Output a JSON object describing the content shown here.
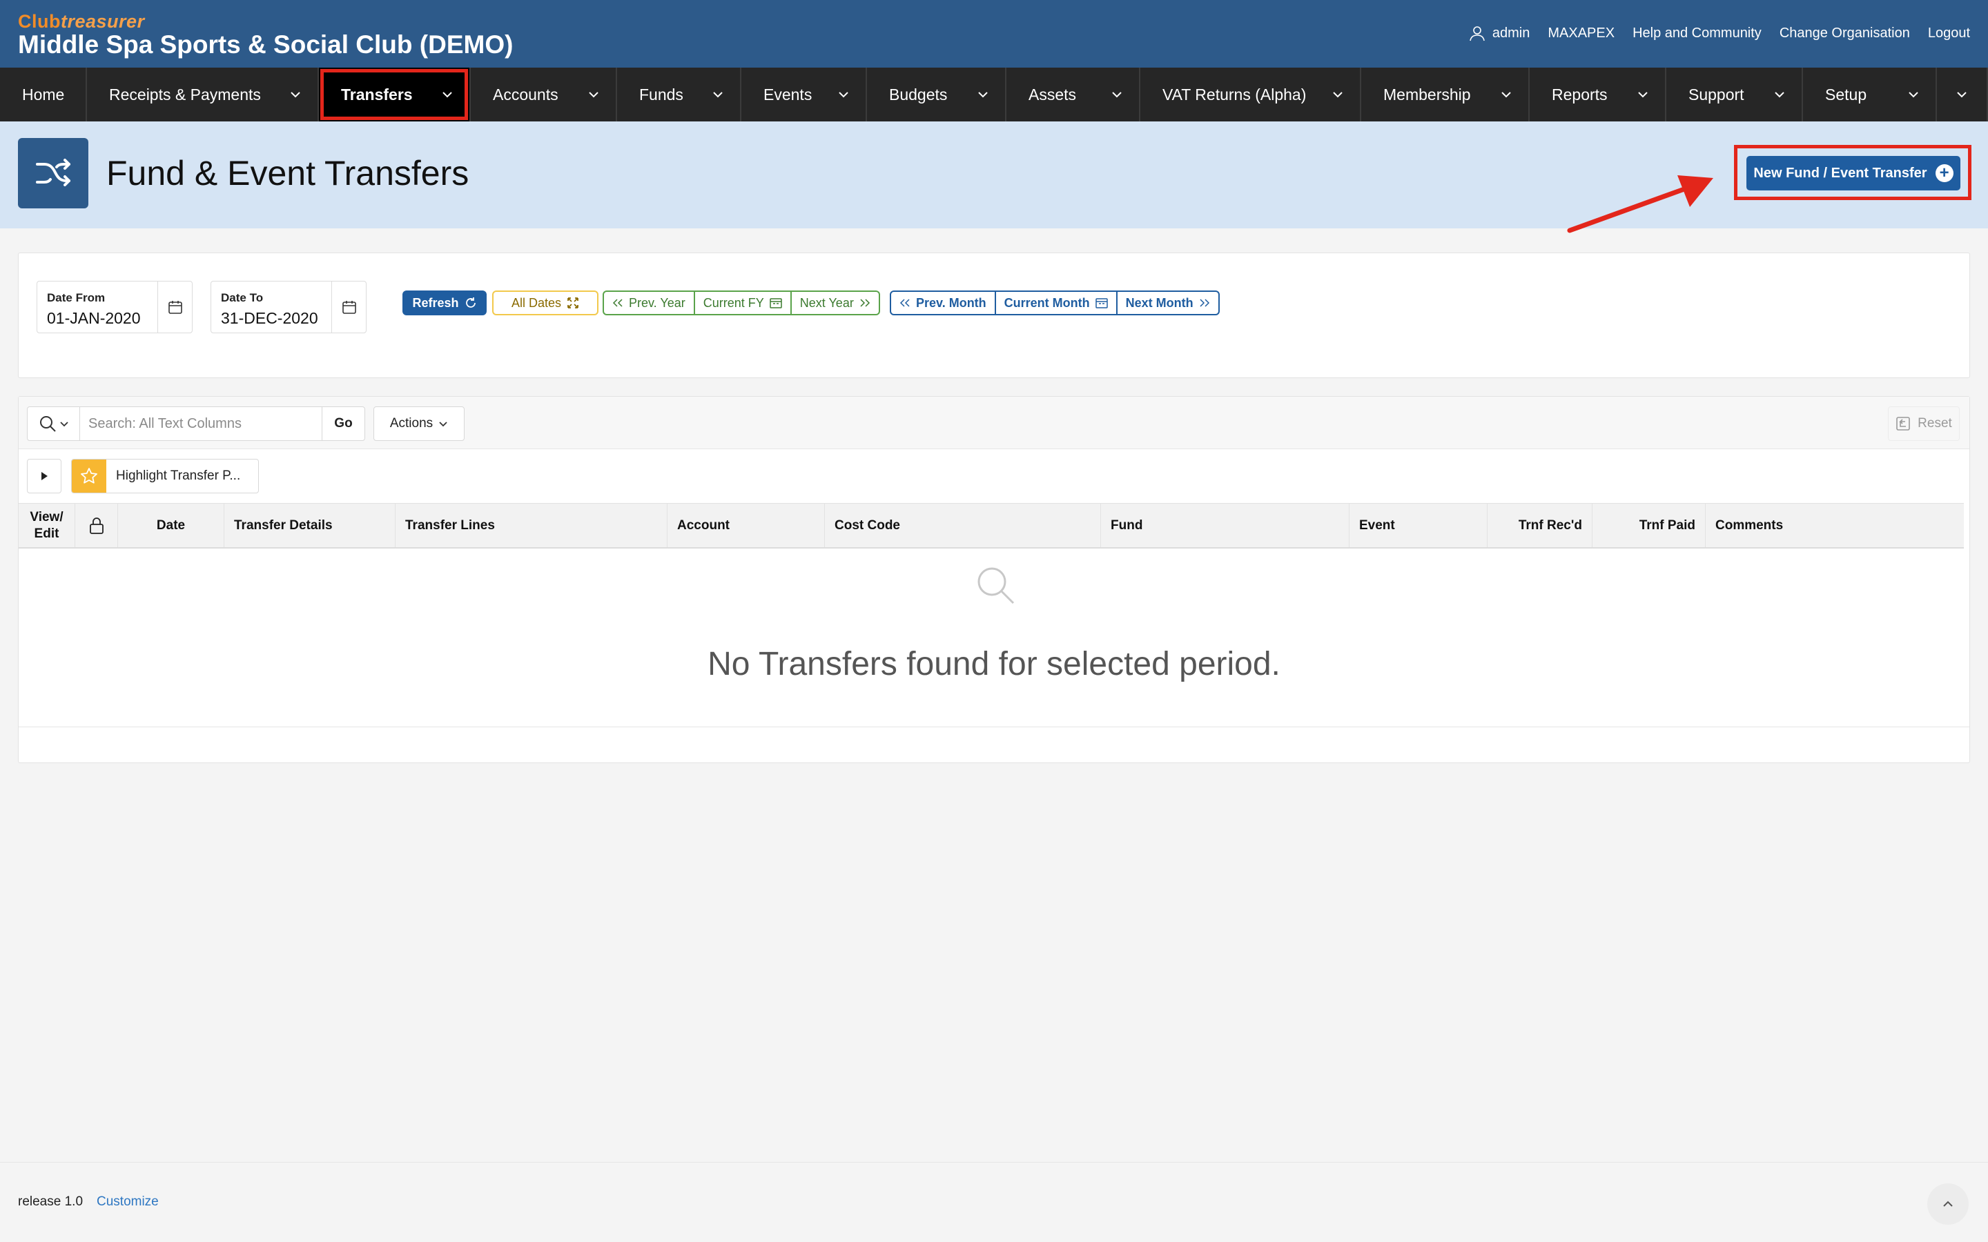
{
  "header": {
    "logo_club": "Club",
    "logo_treasurer": "treasurer",
    "app_title": "Middle Spa Sports & Social Club (DEMO)",
    "links": {
      "user": "admin",
      "org_code": "MAXAPEX",
      "help": "Help and Community",
      "change_org": "Change Organisation",
      "logout": "Logout"
    }
  },
  "nav": {
    "items": [
      {
        "label": "Home"
      },
      {
        "label": "Receipts & Payments"
      },
      {
        "label": "Transfers"
      },
      {
        "label": "Accounts"
      },
      {
        "label": "Funds"
      },
      {
        "label": "Events"
      },
      {
        "label": "Budgets"
      },
      {
        "label": "Assets"
      },
      {
        "label": "VAT Returns (Alpha)"
      },
      {
        "label": "Membership"
      },
      {
        "label": "Reports"
      },
      {
        "label": "Support"
      },
      {
        "label": "Setup"
      }
    ],
    "active": "Transfers"
  },
  "hero": {
    "title": "Fund & Event Transfers",
    "new_button": "New Fund / Event Transfer"
  },
  "filters": {
    "date_from": {
      "label": "Date From",
      "value": "01-JAN-2020"
    },
    "date_to": {
      "label": "Date To",
      "value": "31-DEC-2020"
    },
    "refresh": "Refresh",
    "all_dates": "All Dates",
    "prev_year": "Prev. Year",
    "current_fy": "Current FY",
    "next_year": "Next Year",
    "prev_month": "Prev. Month",
    "current_month": "Current Month",
    "next_month": "Next Month"
  },
  "report": {
    "search_placeholder": "Search: All Text Columns",
    "go": "Go",
    "actions": "Actions",
    "reset": "Reset",
    "highlight": "Highlight Transfer P...",
    "columns": {
      "view_edit": "View/ Edit",
      "date": "Date",
      "transfer_details": "Transfer Details",
      "transfer_lines": "Transfer Lines",
      "account": "Account",
      "cost_code": "Cost Code",
      "fund": "Fund",
      "event": "Event",
      "trnf_recd": "Trnf Rec'd",
      "trnf_paid": "Trnf Paid",
      "comments": "Comments"
    },
    "empty_message": "No Transfers found for selected period."
  },
  "footer": {
    "release": "release 1.0",
    "customize": "Customize"
  },
  "colors": {
    "header_bg": "#2d5a8a",
    "nav_bg": "#262626",
    "highlight_red": "#e3261b",
    "primary_button": "#1f5da0",
    "hero_bg": "#d5e4f4"
  }
}
